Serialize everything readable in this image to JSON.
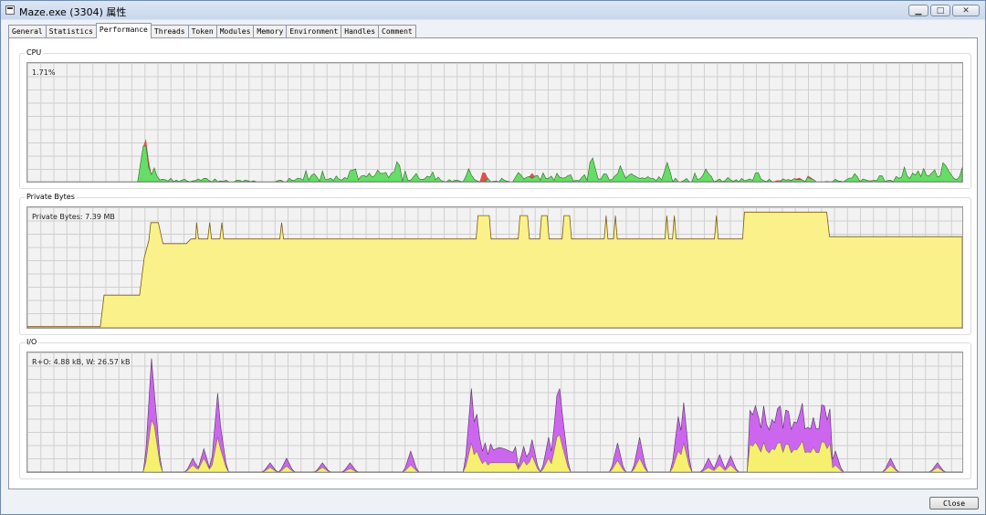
{
  "window": {
    "title": "Maze.exe (3304) 属性",
    "buttons": [
      "minimize",
      "maximize",
      "close"
    ]
  },
  "tabs": [
    {
      "label": "General",
      "active": false
    },
    {
      "label": "Statistics",
      "active": false
    },
    {
      "label": "Performance",
      "active": true
    },
    {
      "label": "Threads",
      "active": false
    },
    {
      "label": "Token",
      "active": false
    },
    {
      "label": "Modules",
      "active": false
    },
    {
      "label": "Memory",
      "active": false
    },
    {
      "label": "Environment",
      "active": false
    },
    {
      "label": "Handles",
      "active": false
    },
    {
      "label": "Comment",
      "active": false
    }
  ],
  "cpu": {
    "group_label": "CPU",
    "caption": "1.71%",
    "colors": {
      "kernel": "#e05050",
      "user": "#66dd66",
      "line": "#2a6a2a"
    }
  },
  "private_bytes": {
    "group_label": "Private Bytes",
    "caption": "Private Bytes: 7.39 MB",
    "colors": {
      "fill": "#fbf18a",
      "line": "#7a5a10"
    }
  },
  "io": {
    "group_label": "I/O",
    "caption": "R+O: 4.88 kB, W: 26.57 kB",
    "colors": {
      "ro": "#cc66ee",
      "w": "#f5f070",
      "line": "#553366"
    }
  },
  "footer": {
    "close_label": "Close"
  }
}
